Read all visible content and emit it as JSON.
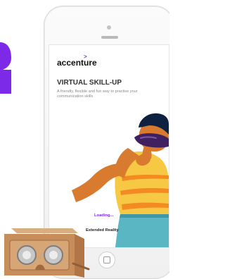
{
  "app": {
    "brand_name": "accenture",
    "brand_mark": ">",
    "title": "VIRTUAL SKILL-UP",
    "subtitle": "A friendly, flexible and fun way to practise your communication skills"
  },
  "status": {
    "loading": "Loading...",
    "footer": "Extended Reality"
  },
  "colors": {
    "accent": "#7d2ae8",
    "skin": "#d87b2f",
    "shirt": "#f7c844",
    "stripe": "#f38a22",
    "pants": "#5ab6c3",
    "hair": "#0f2140",
    "visor": "#40205f",
    "cardboard": "#c78d5a"
  },
  "icons": {
    "home": "home-button-icon",
    "viewer": "cardboard-vr-viewer",
    "mascot": "vr-user-illustration"
  }
}
